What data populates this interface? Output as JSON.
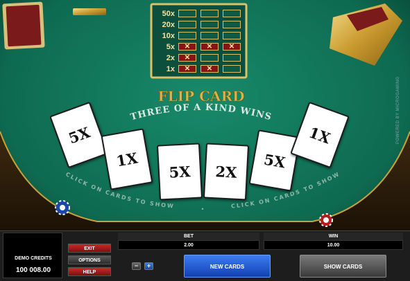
{
  "paytable": {
    "rows": [
      {
        "label": "50x",
        "marks": [
          false,
          false,
          false
        ]
      },
      {
        "label": "20x",
        "marks": [
          false,
          false,
          false
        ]
      },
      {
        "label": "10x",
        "marks": [
          false,
          false,
          false
        ]
      },
      {
        "label": "5x",
        "marks": [
          true,
          true,
          true
        ]
      },
      {
        "label": "2x",
        "marks": [
          true,
          false,
          false
        ]
      },
      {
        "label": "1x",
        "marks": [
          true,
          true,
          false
        ]
      }
    ],
    "mark_symbol": "✕"
  },
  "game_title": "FLIP CARD",
  "arc_text_top": "THREE OF A KIND WINS",
  "arc_text_bottom_left": "CLICK ON CARDS TO SHOW",
  "arc_text_bottom_right": "CLICK ON CARDS TO SHOW",
  "separator": "•",
  "cards": [
    "5X",
    "1X",
    "5X",
    "2X",
    "5X",
    "1X"
  ],
  "side_text": "POWERED BY MICROGAMING",
  "panel": {
    "credits_label": "DEMO CREDITS",
    "credits_value": "100 008.00",
    "exit_label": "EXIT",
    "options_label": "OPTIONS",
    "help_label": "HELP",
    "bet_label": "BET",
    "bet_value": "2.00",
    "win_label": "WIN",
    "win_value": "10.00",
    "minus_label": "−",
    "plus_label": "+",
    "new_cards_label": "NEW CARDS",
    "show_cards_label": "SHOW CARDS"
  },
  "colors": {
    "felt": "#0e6a50",
    "gold": "#d4b04a",
    "blue_button": "#1f5fd6",
    "red_button": "#a51c1c"
  }
}
